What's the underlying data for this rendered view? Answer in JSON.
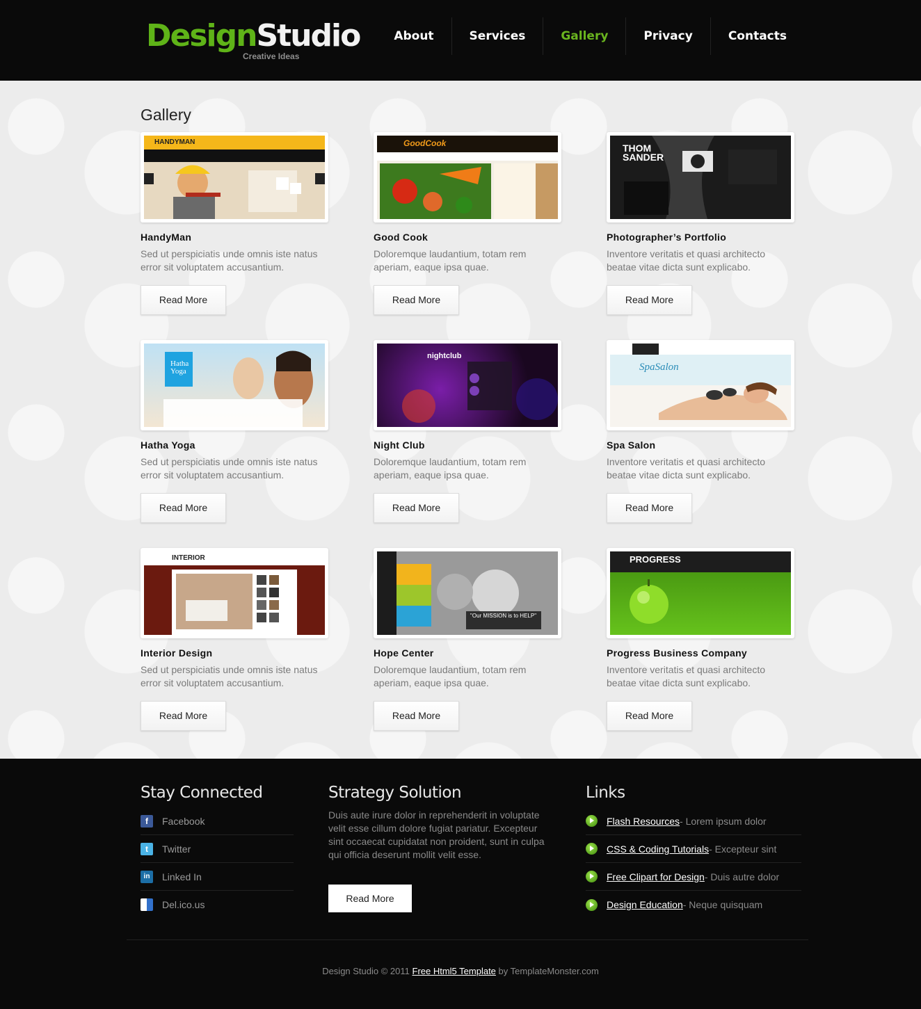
{
  "logo": {
    "part1": "Design",
    "part2": "Studio",
    "tagline": "Creative Ideas"
  },
  "nav": [
    {
      "label": "About",
      "active": false
    },
    {
      "label": "Services",
      "active": false
    },
    {
      "label": "Gallery",
      "active": true
    },
    {
      "label": "Privacy",
      "active": false
    },
    {
      "label": "Contacts",
      "active": false
    }
  ],
  "gallery": {
    "title": "Gallery",
    "read_more": "Read More",
    "items": [
      {
        "title": "HandyMan",
        "desc": "Sed ut perspiciatis unde omnis iste natus error sit voluptatem accusantium.",
        "thumb_label": "HANDYMAN"
      },
      {
        "title": "Good Cook",
        "desc": "Doloremque laudantium, totam rem aperiam, eaque ipsa quae.",
        "thumb_label": "GoodCook"
      },
      {
        "title": "Photographer’s Portfolio",
        "desc": "Inventore veritatis et quasi architecto beatae vitae dicta sunt explicabo.",
        "thumb_label": "THOM SANDER"
      },
      {
        "title": "Hatha Yoga",
        "desc": "Sed ut perspiciatis unde omnis iste natus error sit voluptatem accusantium.",
        "thumb_label": "Hatha Yoga"
      },
      {
        "title": "Night Club",
        "desc": "Doloremque laudantium, totam rem aperiam, eaque ipsa quae.",
        "thumb_label": "nightclub"
      },
      {
        "title": "Spa Salon",
        "desc": "Inventore veritatis et quasi architecto beatae vitae dicta sunt explicabo.",
        "thumb_label": "SpaSalon"
      },
      {
        "title": "Interior Design",
        "desc": "Sed ut perspiciatis unde omnis iste natus error sit voluptatem accusantium.",
        "thumb_label": "INTERIOR"
      },
      {
        "title": "Hope Center",
        "desc": "Doloremque laudantium, totam rem aperiam, eaque ipsa quae.",
        "thumb_label": "\"Our MISSION is to HELP\""
      },
      {
        "title": "Progress Business Company",
        "desc": "Inventore veritatis et quasi architecto beatae vitae dicta sunt explicabo.",
        "thumb_label": "PROGRESS"
      }
    ]
  },
  "footer": {
    "stay_connected": {
      "title": "Stay Connected",
      "items": [
        {
          "label": "Facebook",
          "icon": "facebook-icon",
          "color": "#3b5998"
        },
        {
          "label": "Twitter",
          "icon": "twitter-icon",
          "color": "#4ab3e6"
        },
        {
          "label": "Linked In",
          "icon": "linkedin-icon",
          "color": "#1c6ea6"
        },
        {
          "label": "Del.ico.us",
          "icon": "delicious-icon",
          "color": "#3271cb"
        }
      ]
    },
    "strategy": {
      "title": "Strategy Solution",
      "text": "Duis aute irure dolor in reprehenderit in voluptate velit esse cillum dolore fugiat pariatur. Excepteur sint occaecat cupidatat non proident, sunt in culpa qui officia deserunt mollit velit esse.",
      "button": "Read More"
    },
    "links": {
      "title": "Links",
      "items": [
        {
          "link": "Flash Resources",
          "text": " - Lorem ipsum dolor"
        },
        {
          "link": "CSS & Coding Tutorials",
          "text": " - Excepteur sint"
        },
        {
          "link": "Free Clipart for Design",
          "text": " - Duis autre dolor"
        },
        {
          "link": "Design Education",
          "text": " - Neque quisquam"
        }
      ]
    },
    "copyright": {
      "prefix": "Design Studio © 2011 ",
      "link": "Free Html5 Template",
      "suffix": " by TemplateMonster.com"
    }
  },
  "colors": {
    "accent": "#5fb318",
    "header_bg": "#0a0a0a",
    "main_bg": "#ececec"
  }
}
